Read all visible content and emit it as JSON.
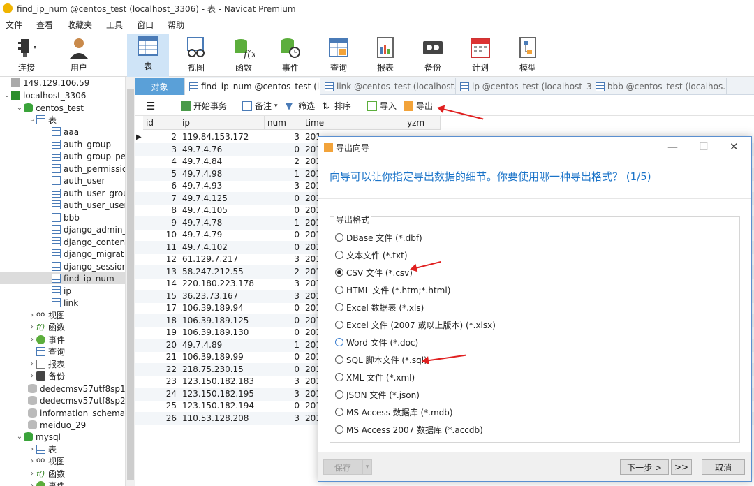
{
  "window": {
    "title": "find_ip_num @centos_test (localhost_3306) - 表 - Navicat Premium"
  },
  "menu": [
    "文件",
    "查看",
    "收藏夹",
    "工具",
    "窗口",
    "帮助"
  ],
  "toolbar": {
    "connect": "连接",
    "user": "用户",
    "table": "表",
    "view": "视图",
    "function": "函数",
    "event": "事件",
    "query": "查询",
    "report": "报表",
    "backup": "备份",
    "schedule": "计划",
    "model": "模型"
  },
  "tree": {
    "conn1": "149.129.106.59",
    "conn2": "localhost_3306",
    "db": "centos_test",
    "tables_label": "表",
    "tables": [
      "aaa",
      "auth_group",
      "auth_group_pe",
      "auth_permissic",
      "auth_user",
      "auth_user_grou",
      "auth_user_user",
      "bbb",
      "django_admin_",
      "django_conten",
      "django_migrat",
      "django_session",
      "find_ip_num",
      "ip",
      "link"
    ],
    "view": "视图",
    "func": "函数",
    "event": "事件",
    "query": "查询",
    "report": "报表",
    "backup": "备份",
    "other_dbs": [
      "dedecmsv57utf8sp1",
      "dedecmsv57utf8sp2",
      "information_schema",
      "meiduo_29"
    ],
    "mysql": "mysql",
    "mysql_items": [
      "表",
      "视图",
      "函数",
      "事件"
    ]
  },
  "tabs": {
    "objects": "对象",
    "t1": "find_ip_num @centos_test (l...",
    "t2": "link @centos_test (localhost...",
    "t3": "ip @centos_test (localhost_3...",
    "t4": "bbb @centos_test (localhos..."
  },
  "objbar": {
    "begin": "开始事务",
    "memo": "备注",
    "filter": "筛选",
    "sort": "排序",
    "import": "导入",
    "export": "导出"
  },
  "grid": {
    "columns": [
      "id",
      "ip",
      "num",
      "time",
      "yzm"
    ],
    "rows": [
      [
        "2",
        "119.84.153.172",
        "3",
        "201",
        ""
      ],
      [
        "3",
        "49.7.4.76",
        "0",
        "201",
        ""
      ],
      [
        "4",
        "49.7.4.84",
        "2",
        "201",
        ""
      ],
      [
        "5",
        "49.7.4.98",
        "1",
        "201",
        ""
      ],
      [
        "6",
        "49.7.4.93",
        "3",
        "201",
        ""
      ],
      [
        "7",
        "49.7.4.125",
        "0",
        "201",
        ""
      ],
      [
        "8",
        "49.7.4.105",
        "0",
        "201",
        ""
      ],
      [
        "9",
        "49.7.4.78",
        "1",
        "201",
        ""
      ],
      [
        "10",
        "49.7.4.79",
        "0",
        "201",
        ""
      ],
      [
        "11",
        "49.7.4.102",
        "0",
        "201",
        ""
      ],
      [
        "12",
        "61.129.7.217",
        "3",
        "201",
        ""
      ],
      [
        "13",
        "58.247.212.55",
        "2",
        "201",
        ""
      ],
      [
        "14",
        "220.180.223.178",
        "3",
        "201",
        ""
      ],
      [
        "15",
        "36.23.73.167",
        "3",
        "201",
        ""
      ],
      [
        "17",
        "106.39.189.94",
        "0",
        "201",
        ""
      ],
      [
        "18",
        "106.39.189.125",
        "0",
        "201",
        ""
      ],
      [
        "19",
        "106.39.189.130",
        "0",
        "201",
        ""
      ],
      [
        "20",
        "49.7.4.89",
        "1",
        "201",
        ""
      ],
      [
        "21",
        "106.39.189.99",
        "0",
        "201",
        ""
      ],
      [
        "22",
        "218.75.230.15",
        "0",
        "201",
        ""
      ],
      [
        "23",
        "123.150.182.183",
        "3",
        "201",
        ""
      ],
      [
        "24",
        "123.150.182.195",
        "3",
        "201",
        ""
      ],
      [
        "25",
        "123.150.182.194",
        "0",
        "201",
        ""
      ],
      [
        "26",
        "110.53.128.208",
        "3",
        "201",
        ""
      ]
    ]
  },
  "dialog": {
    "title": "导出向导",
    "question": "向导可以让你指定导出数据的细节。你要使用哪一种导出格式？ (1/5)",
    "group_label": "导出格式",
    "options": [
      "DBase 文件 (*.dbf)",
      "文本文件 (*.txt)",
      "CSV 文件 (*.csv)",
      "HTML 文件 (*.htm;*.html)",
      "Excel 数据表 (*.xls)",
      "Excel 文件 (2007 或以上版本) (*.xlsx)",
      "Word 文件 (*.doc)",
      "SQL 脚本文件 (*.sql)",
      "XML 文件 (*.xml)",
      "JSON 文件 (*.json)",
      "MS Access 数据库 (*.mdb)",
      "MS Access 2007 数据库 (*.accdb)"
    ],
    "selected": "CSV 文件 (*.csv)",
    "save": "保存",
    "next": "下一步 >",
    "last": ">>",
    "cancel": "取消"
  },
  "colors": {
    "accent": "#1a73c8",
    "annotation_arrow": "#e02020",
    "selected_tab": "#5aa0d8"
  }
}
